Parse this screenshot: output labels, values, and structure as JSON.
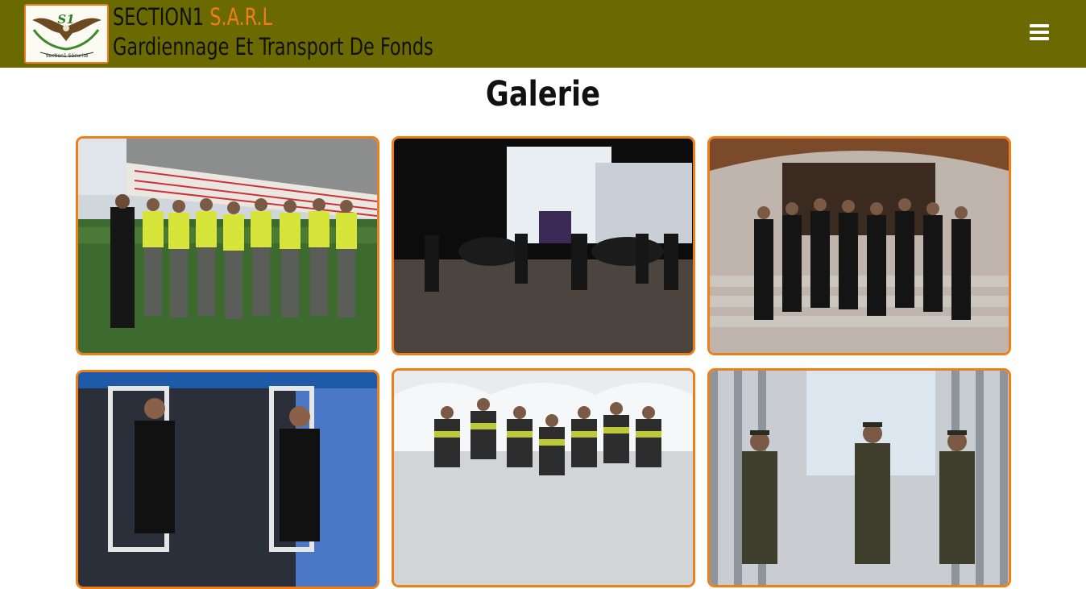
{
  "header": {
    "brand_name": "SECTION1",
    "brand_suffix": "S.A.R.L",
    "tagline": "Gardiennage Et Transport De Fonds",
    "logo_text": "S1",
    "logo_caption": "Section1 Sécurité",
    "menu_icon": "hamburger-menu-icon",
    "background_color": "#6b6a00",
    "accent_color": "#f07e18"
  },
  "page": {
    "title": "Galerie"
  },
  "gallery": {
    "items": [
      {
        "photo": "guards-stadium-reflective-vests"
      },
      {
        "photo": "guards-night-villa-cars"
      },
      {
        "photo": "guards-black-suits-stairs"
      },
      {
        "photo": "guards-suits-doorway"
      },
      {
        "photo": "guards-vests-building"
      },
      {
        "photo": "guards-olive-uniforms"
      }
    ]
  }
}
